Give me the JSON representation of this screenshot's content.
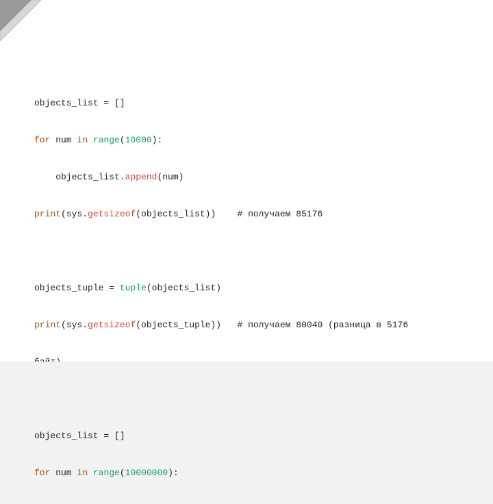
{
  "code": {
    "l1": {
      "a": "objects_list = []"
    },
    "l2": {
      "a": "for",
      "b": " num ",
      "c": "in",
      "d": " ",
      "e": "range",
      "f": "(",
      "g": "10000",
      "h": "):"
    },
    "l3": {
      "a": "objects_list.",
      "b": "append",
      "c": "(num)"
    },
    "l4": {
      "a": "print",
      "b": "(sys.",
      "c": "getsizeof",
      "d": "(objects_list))    # получаем 85176"
    },
    "l5": {
      "a": ""
    },
    "l6": {
      "a": "objects_tuple = ",
      "b": "tuple",
      "c": "(objects_list)"
    },
    "l7": {
      "a": "print",
      "b": "(sys.",
      "c": "getsizeof",
      "d": "(objects_tuple))   # получаем 80040 (разница в 5176"
    },
    "l8": {
      "a": "байт)"
    },
    "l9": {
      "a": ""
    },
    "l10": {
      "a": "objects_list = []"
    },
    "l11": {
      "a": "for",
      "b": " num ",
      "c": "in",
      "d": " ",
      "e": "range",
      "f": "(",
      "g": "10000000",
      "h": "):"
    }
  }
}
